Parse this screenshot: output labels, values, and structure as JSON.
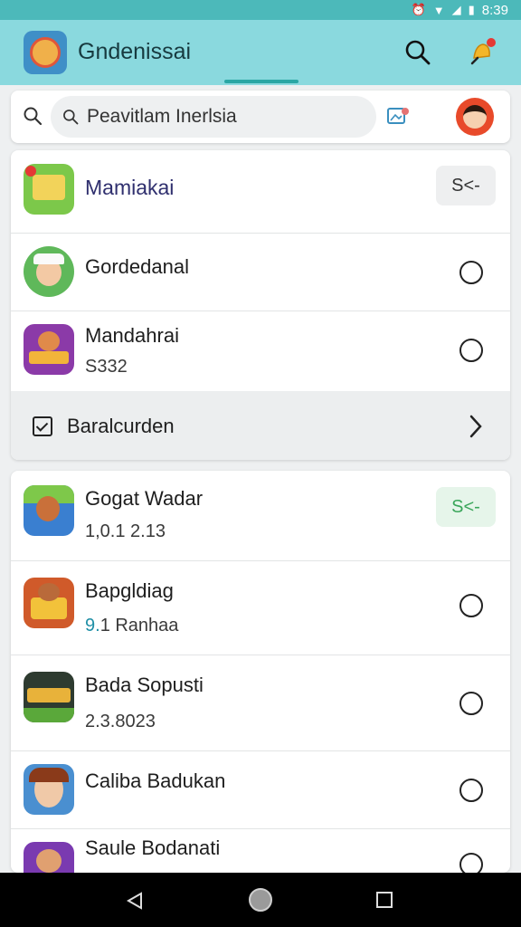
{
  "status_bar": {
    "time": "8:39"
  },
  "app_bar": {
    "title": "Gndenissai"
  },
  "search": {
    "placeholder": "Peavitlam Inerlsia"
  },
  "section1": {
    "featured": {
      "title": "Mamiakai",
      "action_label": "S<-"
    },
    "items": [
      {
        "title": "Gordedanal"
      },
      {
        "title": "Mandahrai",
        "subtitle": "S332"
      }
    ],
    "footer": {
      "label": "Baralcurden"
    }
  },
  "section2": {
    "items": [
      {
        "title": "Gogat Wadar",
        "subtitle": "1,0.1 2.13",
        "action_label": "S<-"
      },
      {
        "title": "Bapgldiag",
        "subtitle_accent": "9.",
        "subtitle": "1 Ranhaa"
      },
      {
        "title": "Bada Sopusti",
        "subtitle": "2.3.8023"
      },
      {
        "title": "Caliba Badukan"
      },
      {
        "title": "Saule Bodanati"
      }
    ]
  },
  "colors": {
    "app_bar": "#8ad9de",
    "status_bar": "#4cb9ba",
    "accent": "#2aa7a5"
  }
}
